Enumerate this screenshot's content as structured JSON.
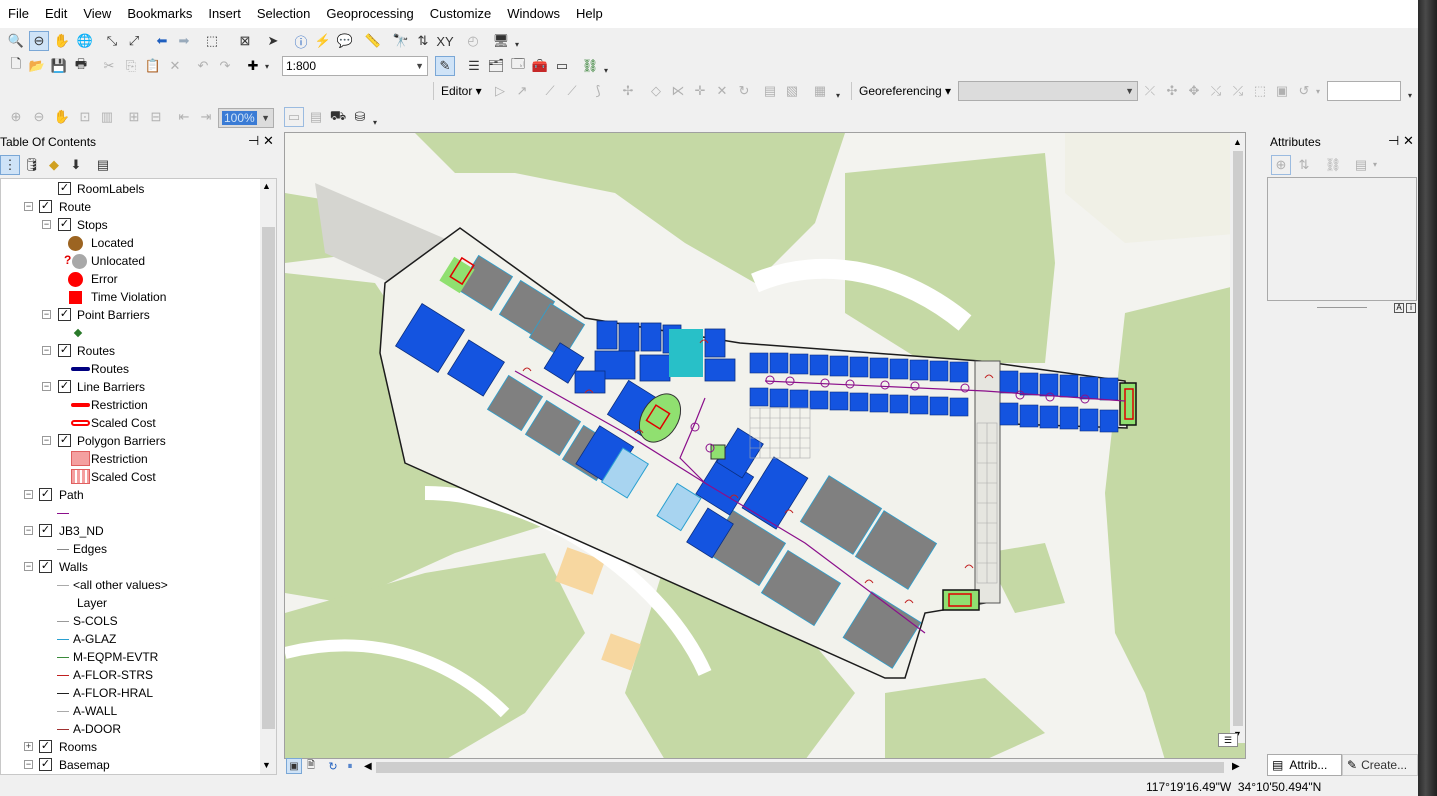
{
  "menu": [
    "File",
    "Edit",
    "View",
    "Bookmarks",
    "Insert",
    "Selection",
    "Geoprocessing",
    "Customize",
    "Windows",
    "Help"
  ],
  "toolbar": {
    "scale_value": "1:800",
    "editor_label": "Editor ▾",
    "georef_label": "Georeferencing ▾",
    "zoom_percent": "100%"
  },
  "toc": {
    "title": "Table Of Contents",
    "pin": "⊣",
    "close": "✕",
    "rows": [
      {
        "label": "RoomLabels"
      },
      {
        "label": "Route"
      },
      {
        "label": "Stops"
      },
      {
        "label": "Located"
      },
      {
        "label": "Unlocated"
      },
      {
        "label": "Error"
      },
      {
        "label": "Time Violation"
      },
      {
        "label": "Point Barriers"
      },
      {
        "label": ""
      },
      {
        "label": "Routes"
      },
      {
        "label": "Routes"
      },
      {
        "label": "Line Barriers"
      },
      {
        "label": "Restriction"
      },
      {
        "label": "Scaled Cost"
      },
      {
        "label": "Polygon Barriers"
      },
      {
        "label": "Restriction"
      },
      {
        "label": "Scaled Cost"
      },
      {
        "label": "Path"
      },
      {
        "label": ""
      },
      {
        "label": "JB3_ND"
      },
      {
        "label": "Edges"
      },
      {
        "label": "Walls"
      },
      {
        "label": "<all other values>"
      },
      {
        "label": "Layer"
      },
      {
        "label": "S-COLS"
      },
      {
        "label": "A-GLAZ"
      },
      {
        "label": "M-EQPM-EVTR"
      },
      {
        "label": "A-FLOR-STRS"
      },
      {
        "label": "A-FLOR-HRAL"
      },
      {
        "label": "A-WALL"
      },
      {
        "label": "A-DOOR"
      },
      {
        "label": "Rooms"
      },
      {
        "label": "Basemap"
      }
    ]
  },
  "attributes": {
    "title": "Attributes",
    "close": "✕",
    "tab_attrib": "Attrib...",
    "tab_create": "Create..."
  },
  "status": {
    "coordinates": "117°19'16.49\"W  34°10'50.494\"N"
  },
  "colors": {
    "room_blue": "#1454e0",
    "room_gray": "#808080",
    "park_green": "#c5d9a5",
    "route_purple": "#8b0f8b"
  }
}
